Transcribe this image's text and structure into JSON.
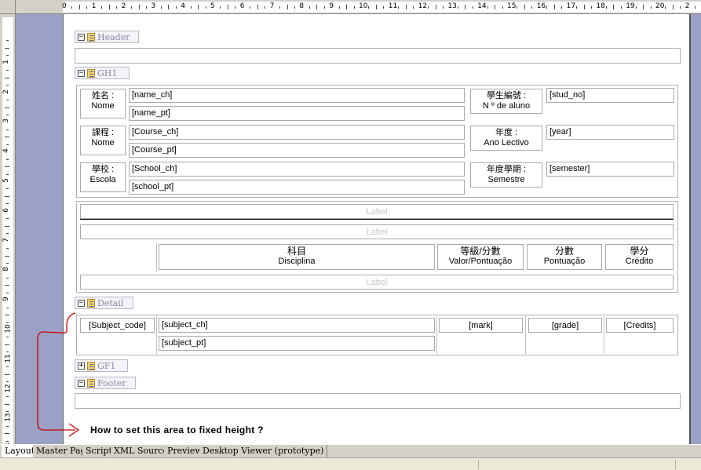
{
  "ruler": {
    "horizontal": [
      "0",
      "1",
      "2",
      "3",
      "4",
      "5",
      "6",
      "7",
      "8",
      "9",
      "10",
      "11",
      "12",
      "13",
      "14",
      "15",
      "16",
      "17",
      "18",
      "19",
      "20",
      "2"
    ],
    "vertical": [
      "1",
      "2",
      "3",
      "4",
      "5",
      "6",
      "7",
      "8",
      "9",
      "10",
      "11",
      "12",
      "13",
      "14"
    ]
  },
  "bands": {
    "header": "Header",
    "gh1": "GH1",
    "detail": "Detail",
    "gf1": "GF1",
    "footer": "Footer"
  },
  "gh1": {
    "name_label_ch": "姓名 :",
    "name_label_pt": "Nome",
    "name_ch": "[name_ch]",
    "name_pt": "[name_pt]",
    "stud_label_ch": "學生編號 :",
    "stud_label_pt": "N º  de aluno",
    "stud_no": "[stud_no]",
    "course_label_ch": "課程 :",
    "course_label_pt": "Nome",
    "course_ch": "[Course_ch]",
    "course_pt": "[Course_pt]",
    "year_label_ch": "年度 :",
    "year_label_pt": "Ano Lectivo",
    "year": "[year]",
    "school_label_ch": "學校 :",
    "school_label_pt": "Escola",
    "school_ch": "[School_ch]",
    "school_pt": "[school_pt]",
    "sem_label_ch": "年度學期 :",
    "sem_label_pt": "Semestre",
    "semester": "[semester]",
    "label1": "Label",
    "label2": "Label",
    "label3": "Label",
    "col_subject_ch": "科目",
    "col_subject_pt": "Disciplina",
    "col_grade_ch": "等級/分數",
    "col_grade_pt": "Valor/Pontuação",
    "col_score_ch": "分數",
    "col_score_pt": "Pontuação",
    "col_credit_ch": "學分",
    "col_credit_pt": "Crédito"
  },
  "detail": {
    "subject_code": "[Subject_code]",
    "subject_ch": "[subject_ch]",
    "subject_pt": "[subject_pt]",
    "mark": "[mark]",
    "grade": "[grade]",
    "credits": "[Credits]"
  },
  "annotation": "How to set this area to fixed height ?",
  "tabs": [
    "Layout",
    "Master Page",
    "Script",
    "XML Source",
    "Preview",
    "Desktop Viewer (prototype)"
  ],
  "colors": {
    "annotation": "#cc0000",
    "canvas": "#9aa1c5"
  }
}
